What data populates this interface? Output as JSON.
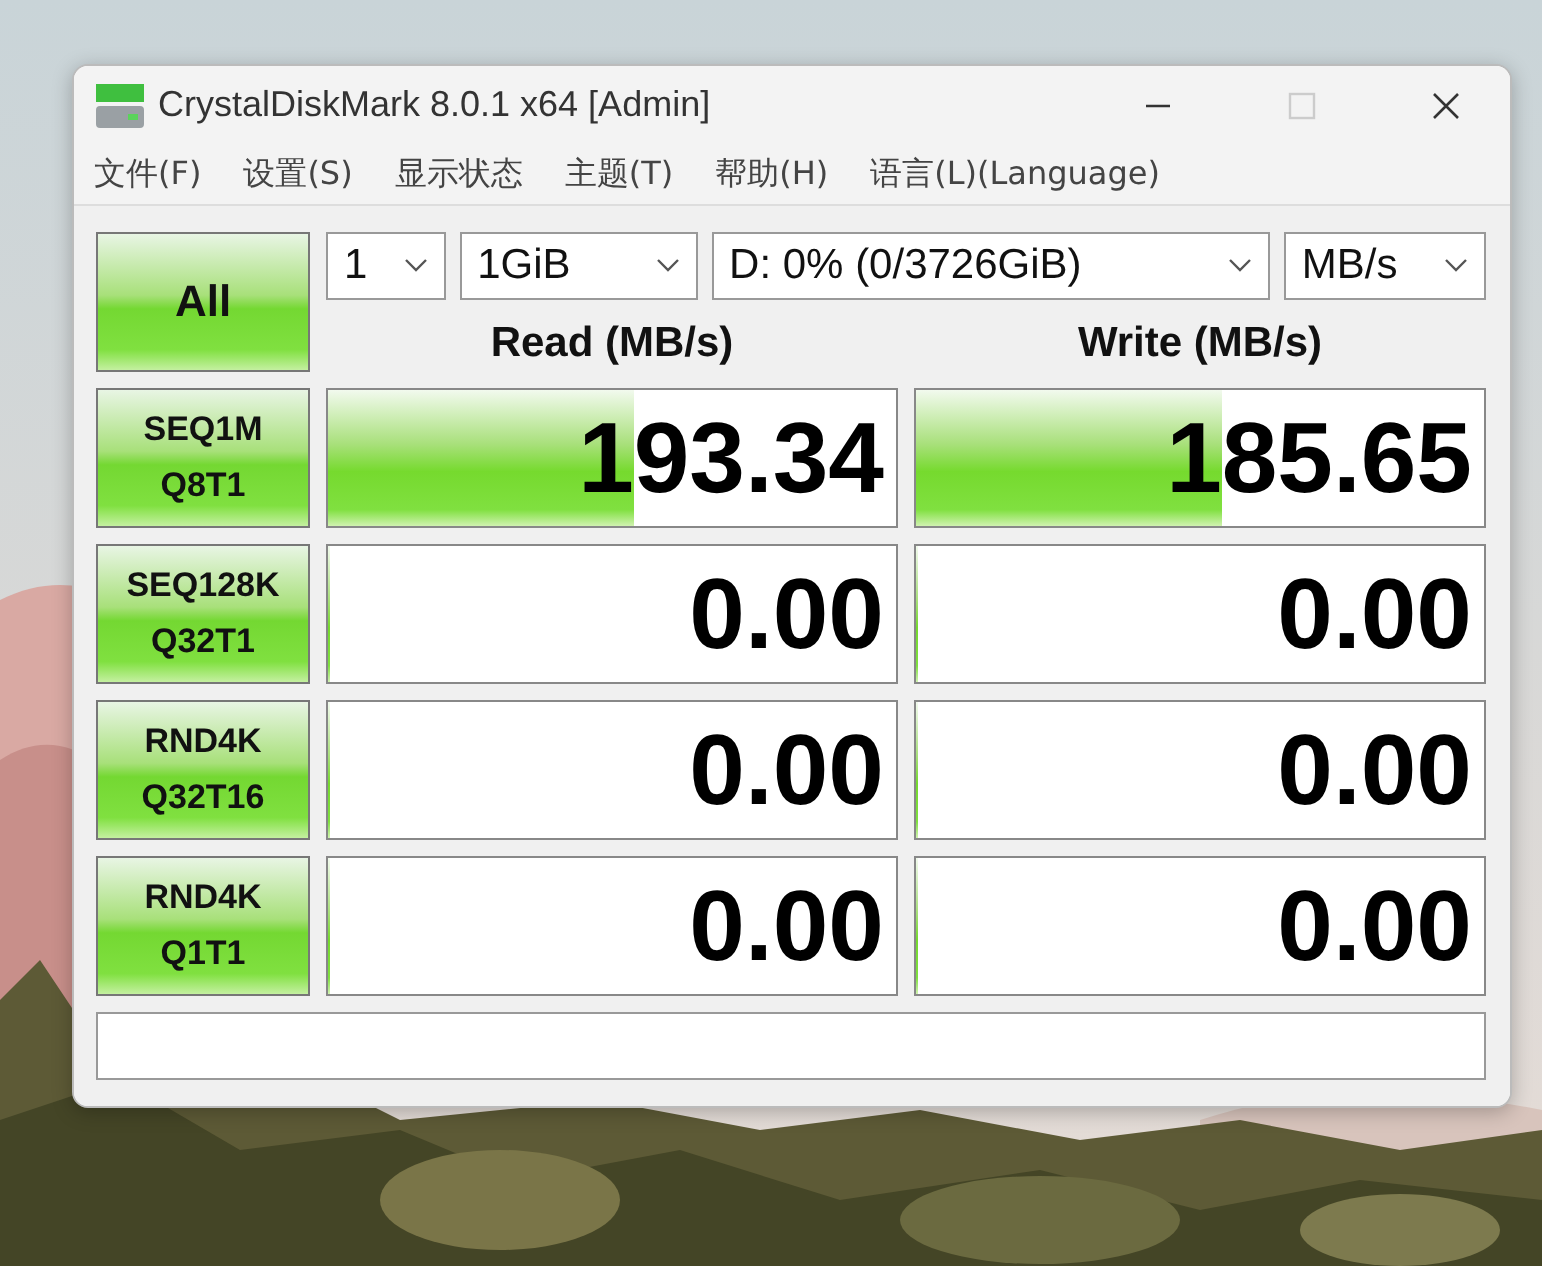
{
  "window": {
    "title": "CrystalDiskMark 8.0.1 x64 [Admin]"
  },
  "menu": [
    "文件(F)",
    "设置(S)",
    "显示状态",
    "主题(T)",
    "帮助(H)",
    "语言(L)(Language)"
  ],
  "all_button": "All",
  "selects": [
    {
      "value": "1"
    },
    {
      "value": "1GiB"
    },
    {
      "value": "D: 0% (0/3726GiB)"
    },
    {
      "value": "MB/s"
    }
  ],
  "columns": [
    "Read (MB/s)",
    "Write (MB/s)"
  ],
  "tests": [
    {
      "line1": "SEQ1M",
      "line2": "Q8T1",
      "read": {
        "value": "193.34",
        "level": 0.54
      },
      "write": {
        "value": "185.65",
        "level": 0.54
      }
    },
    {
      "line1": "SEQ128K",
      "line2": "Q32T1",
      "read": {
        "value": "0.00",
        "level": 0
      },
      "write": {
        "value": "0.00",
        "level": 0
      }
    },
    {
      "line1": "RND4K",
      "line2": "Q32T16",
      "read": {
        "value": "0.00",
        "level": 0
      },
      "write": {
        "value": "0.00",
        "level": 0
      }
    },
    {
      "line1": "RND4K",
      "line2": "Q1T1",
      "read": {
        "value": "0.00",
        "level": 0
      },
      "write": {
        "value": "0.00",
        "level": 0
      }
    }
  ]
}
